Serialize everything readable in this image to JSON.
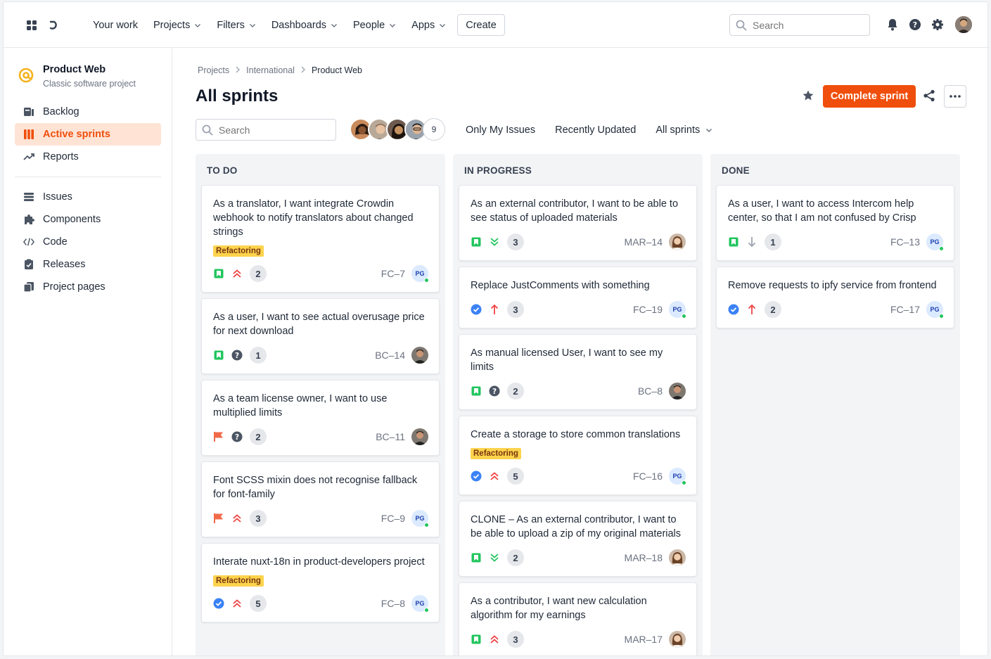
{
  "topnav": {
    "menu": [
      {
        "label": "Your work",
        "dropdown": false
      },
      {
        "label": "Projects",
        "dropdown": true
      },
      {
        "label": "Filters",
        "dropdown": true
      },
      {
        "label": "Dashboards",
        "dropdown": true
      },
      {
        "label": "People",
        "dropdown": true
      },
      {
        "label": "Apps",
        "dropdown": true
      }
    ],
    "create_label": "Create",
    "search_placeholder": "Search"
  },
  "sidebar": {
    "project_name": "Product Web",
    "project_type": "Classic software project",
    "primary": [
      {
        "label": "Backlog",
        "icon": "backlog-icon",
        "active": false
      },
      {
        "label": "Active sprints",
        "icon": "board-icon",
        "active": true
      },
      {
        "label": "Reports",
        "icon": "chart-line-icon",
        "active": false
      }
    ],
    "secondary": [
      {
        "label": "Issues",
        "icon": "layers-icon"
      },
      {
        "label": "Components",
        "icon": "puzzle-icon"
      },
      {
        "label": "Code",
        "icon": "code-icon"
      },
      {
        "label": "Releases",
        "icon": "clipboard-check-icon"
      },
      {
        "label": "Project pages",
        "icon": "pages-icon"
      }
    ]
  },
  "header": {
    "breadcrumb": [
      "Projects",
      "International",
      "Product Web"
    ],
    "title": "All sprints",
    "complete_label": "Complete sprint",
    "accent": "#f04e0c"
  },
  "toolbar": {
    "search_placeholder": "Search",
    "avatar_count": "9",
    "filters": [
      "Only My Issues",
      "Recently Updated"
    ],
    "sprint_select": "All sprints"
  },
  "columns": [
    {
      "title": "TO DO",
      "cards": [
        {
          "title": "As a translator, I want integrate Crowdin webhook to notify translators about changed strings",
          "tag": "Refactoring",
          "type": "story",
          "priority": "highest",
          "points": "2",
          "key": "FC–7",
          "assignee": "PG"
        },
        {
          "title": "As a user, I want to see actual overusage price for next download",
          "tag": "",
          "type": "story",
          "priority": "unknown",
          "points": "1",
          "key": "BC–14",
          "assignee": "face-man"
        },
        {
          "title": "As a team license owner, I want to use multiplied limits",
          "tag": "",
          "type": "flag",
          "priority": "unknown",
          "points": "2",
          "key": "BC–11",
          "assignee": "face-man"
        },
        {
          "title": "Font SCSS mixin does not recognise fallback for font-family",
          "tag": "",
          "type": "flag",
          "priority": "highest",
          "points": "3",
          "key": "FC–9",
          "assignee": "PG"
        },
        {
          "title": "Interate nuxt-18n in product-developers project",
          "tag": "Refactoring",
          "type": "task",
          "priority": "highest",
          "points": "5",
          "key": "FC–8",
          "assignee": "PG"
        }
      ]
    },
    {
      "title": "IN PROGRESS",
      "cards": [
        {
          "title": "As an external contributor, I want to be able to see status of uploaded materials",
          "tag": "",
          "type": "story",
          "priority": "lowest",
          "points": "3",
          "key": "MAR–14",
          "assignee": "face-woman"
        },
        {
          "title": "Replace JustComments with something",
          "tag": "",
          "type": "task",
          "priority": "high",
          "points": "3",
          "key": "FC–19",
          "assignee": "PG"
        },
        {
          "title": "As manual licensed User, I want to see my limits",
          "tag": "",
          "type": "story",
          "priority": "unknown",
          "points": "2",
          "key": "BC–8",
          "assignee": "face-man"
        },
        {
          "title": "Create a storage to store common translations",
          "tag": "Refactoring",
          "type": "task",
          "priority": "highest",
          "points": "5",
          "key": "FC–16",
          "assignee": "PG"
        },
        {
          "title": "CLONE – As an external contributor, I want to be able to upload a zip of my original materials",
          "tag": "",
          "type": "story",
          "priority": "lowest",
          "points": "2",
          "key": "MAR–18",
          "assignee": "face-woman"
        },
        {
          "title": "As a contributor, I want new calculation algorithm for my earnings",
          "tag": "",
          "type": "story",
          "priority": "highest",
          "points": "3",
          "key": "MAR–17",
          "assignee": "face-woman"
        }
      ]
    },
    {
      "title": "DONE",
      "cards": [
        {
          "title": "As a user, I want to access Intercom help center, so that I am not confused by Crisp",
          "tag": "",
          "type": "story",
          "priority": "low",
          "points": "1",
          "key": "FC–13",
          "assignee": "PG"
        },
        {
          "title": "Remove requests to ipfy service from frontend",
          "tag": "",
          "type": "task",
          "priority": "high",
          "points": "2",
          "key": "FC–17",
          "assignee": "PG"
        }
      ]
    }
  ]
}
